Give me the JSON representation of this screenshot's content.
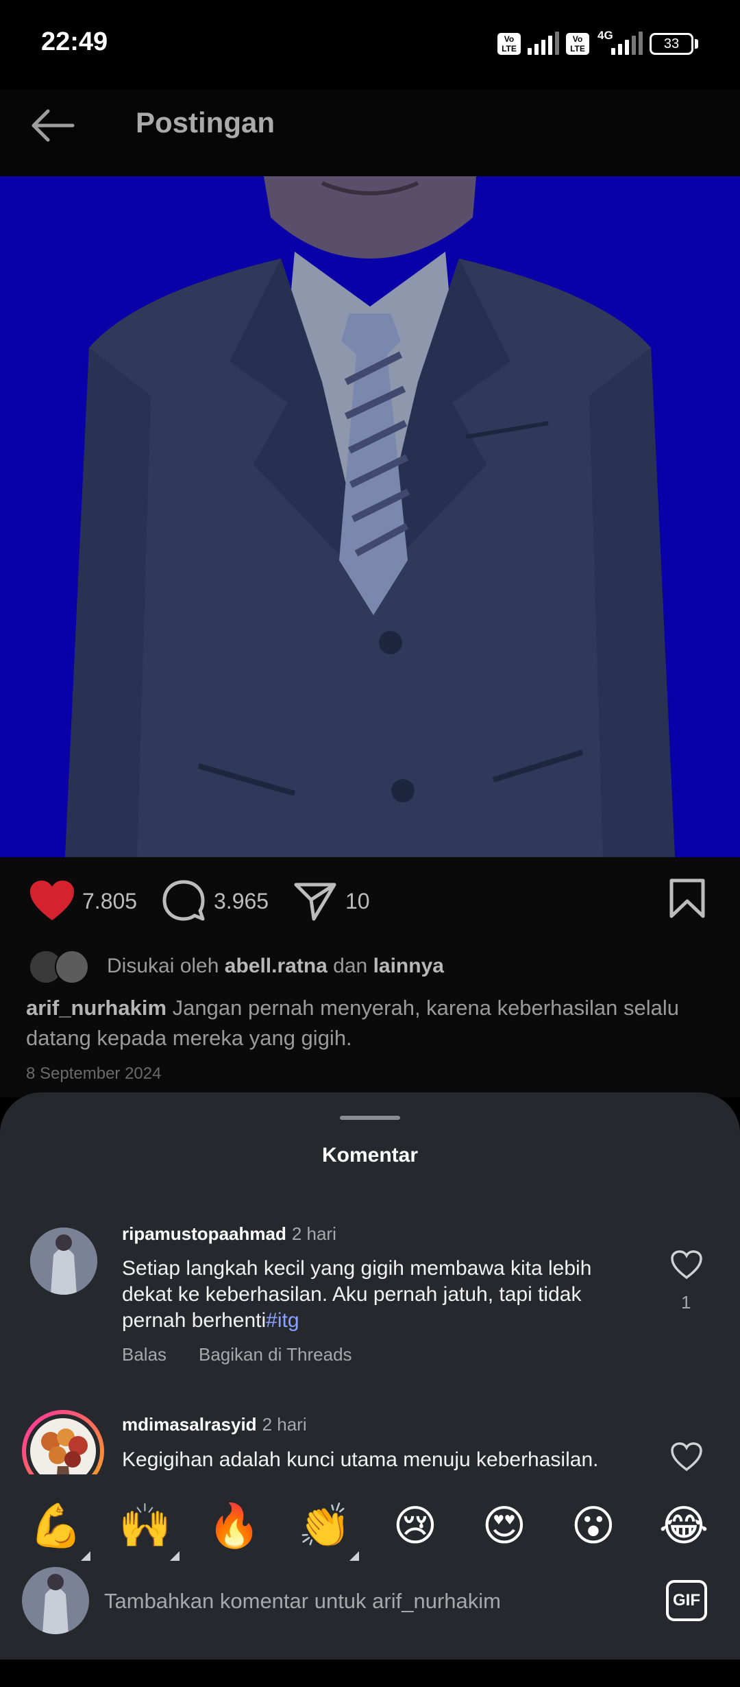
{
  "status_bar": {
    "time": "22:49",
    "volte_1": "Vo LTE",
    "volte_2": "Vo LTE",
    "network": "4G",
    "battery": "33"
  },
  "header": {
    "back_icon": "arrow-left-icon",
    "title": "Postingan"
  },
  "post": {
    "likes_count": "7.805",
    "comments_count": "3.965",
    "shares_count": "10",
    "liked_by_prefix": "Disukai oleh",
    "liked_by_user": "abell.ratna",
    "liked_by_and": "dan",
    "liked_by_others": "lainnya",
    "author": "arif_nurhakim",
    "caption": "Jangan pernah menyerah, karena keberhasilan selalu datang kepada mereka yang gigih.",
    "date": "8 September 2024",
    "colors": {
      "like_red": "#d4232f",
      "image_bg": "#0a00a8"
    }
  },
  "comments_sheet": {
    "title": "Komentar",
    "comments": [
      {
        "username": "ripamustopaahmad",
        "time": "2 hari",
        "text": "Setiap langkah kecil yang gigih membawa kita lebih dekat ke keberhasilan. Aku pernah jatuh, tapi tidak pernah berhenti",
        "hashtag": "#itg",
        "likes": "1",
        "reply_label": "Balas",
        "share_label": "Bagikan di Threads"
      },
      {
        "username": "mdimasalrasyid",
        "time": "2 hari",
        "text": "Kegigihan adalah kunci utama menuju keberhasilan."
      }
    ]
  },
  "emoji_bar": [
    "💪",
    "🙌",
    "🔥",
    "👏",
    "😢",
    "😍",
    "😮",
    "😂"
  ],
  "composer": {
    "placeholder": "Tambahkan komentar untuk arif_nurhakim",
    "gif_label": "GIF"
  }
}
